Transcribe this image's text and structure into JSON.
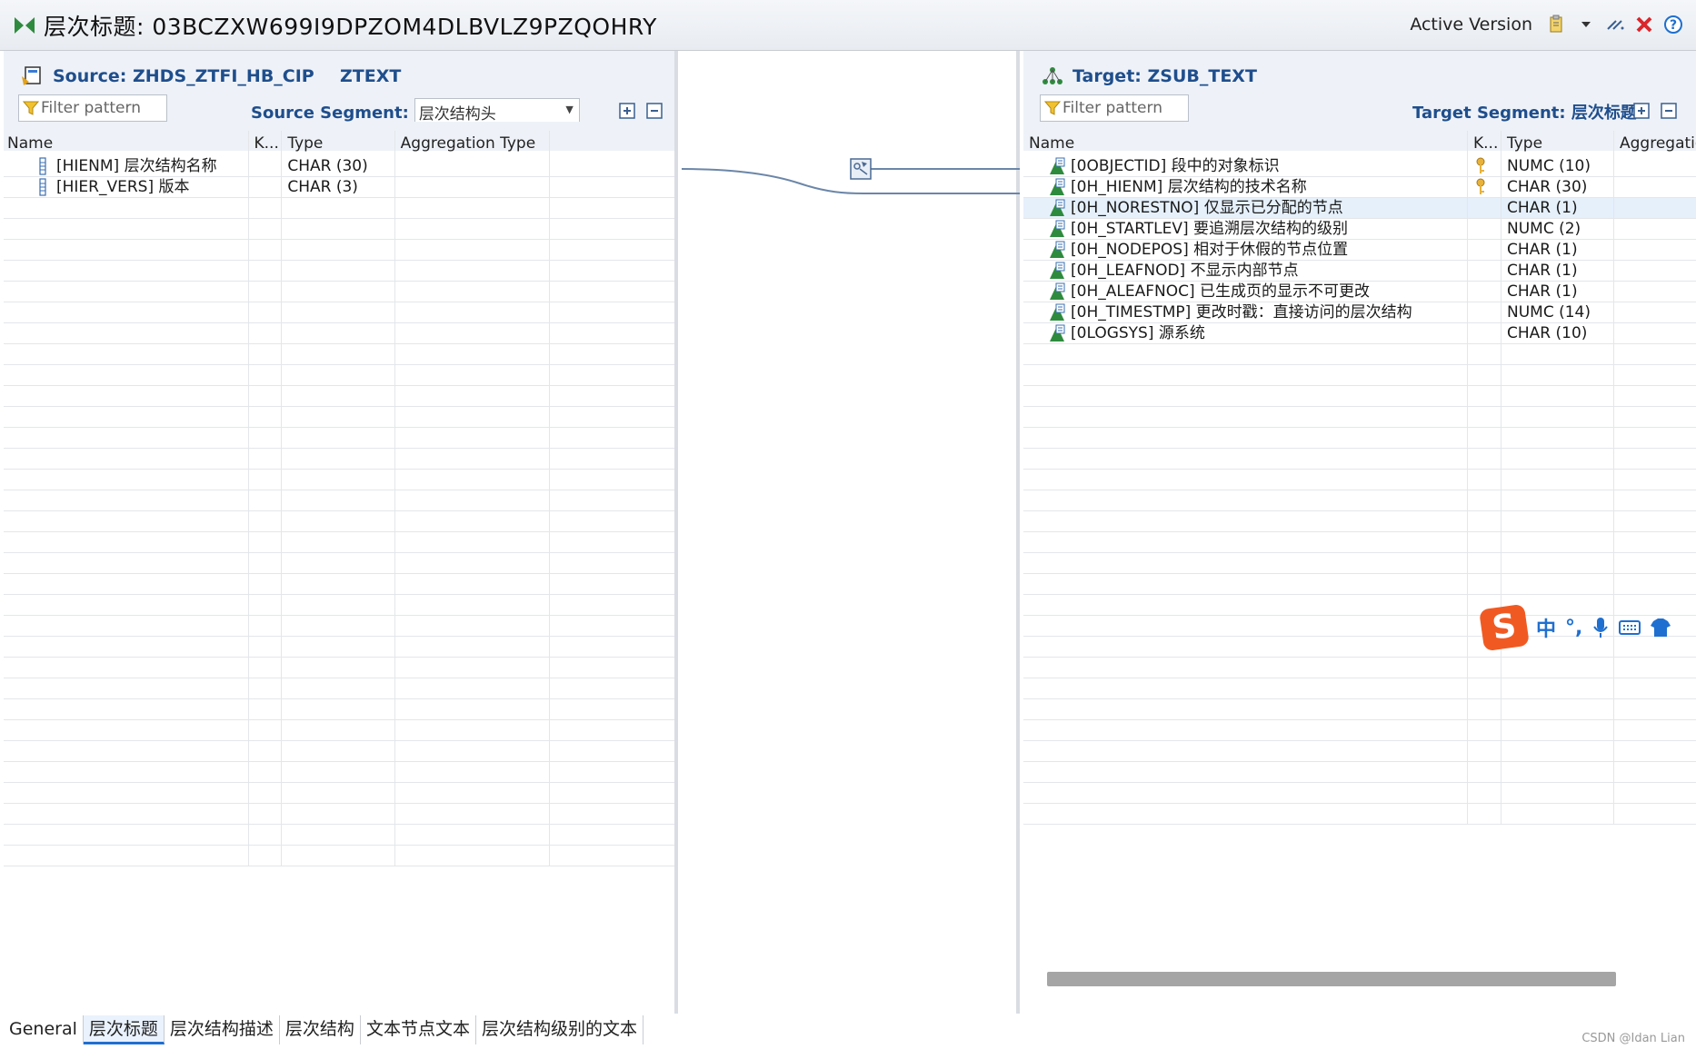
{
  "window": {
    "title": "层次标题: 03BCZXW699I9DPZOM4DLBVLZ9PZQOHRY",
    "version_label": "Active Version"
  },
  "source": {
    "title": "Source: ZHDS_ZTFI_HB_CIP",
    "ztext": "ZTEXT",
    "filter_placeholder": "Filter pattern",
    "segment_label": "Source Segment:",
    "segment_value": "层次结构头",
    "columns": [
      "Name",
      "K...",
      "Type",
      "Aggregation Type",
      ""
    ],
    "rows": [
      {
        "name": "[HIENM] 层次结构名称",
        "type": "CHAR (30)"
      },
      {
        "name": "[HIER_VERS] 版本",
        "type": "CHAR (3)"
      }
    ]
  },
  "target": {
    "title": "Target: ZSUB_TEXT",
    "filter_placeholder": "Filter pattern",
    "segment_label": "Target Segment: 层次标题",
    "columns": [
      "Name",
      "K...",
      "Type",
      "Aggregatio"
    ],
    "rows": [
      {
        "name": "[0OBJECTID] 段中的对象标识",
        "key": true,
        "type": "NUMC (10)"
      },
      {
        "name": "[0H_HIENM] 层次结构的技术名称",
        "key": true,
        "type": "CHAR (30)"
      },
      {
        "name": "[0H_NORESTNO] 仅显示已分配的节点",
        "key": false,
        "type": "CHAR (1)",
        "selected": true
      },
      {
        "name": "[0H_STARTLEV] 要追溯层次结构的级别",
        "key": false,
        "type": "NUMC (2)"
      },
      {
        "name": "[0H_NODEPOS] 相对于休假的节点位置",
        "key": false,
        "type": "CHAR (1)"
      },
      {
        "name": "[0H_LEAFNOD] 不显示内部节点",
        "key": false,
        "type": "CHAR (1)"
      },
      {
        "name": "[0H_ALEAFNOC] 已生成页的显示不可更改",
        "key": false,
        "type": "CHAR (1)"
      },
      {
        "name": "[0H_TIMESTMP] 更改时戳：直接访问的层次结构",
        "key": false,
        "type": "NUMC (14)"
      },
      {
        "name": "[0LOGSYS] 源系统",
        "key": false,
        "type": "CHAR (10)"
      }
    ]
  },
  "tabs": [
    "General",
    "层次标题",
    "层次结构描述",
    "层次结构",
    "文本节点文本",
    "层次结构级别的文本"
  ],
  "active_tab": 1,
  "ime": {
    "mode": "中",
    "punct": "°,"
  },
  "watermark": "CSDN @Idan Lian",
  "colors": {
    "accent": "#1f4e8c",
    "selected_row": "#e5f0fb",
    "close_red": "#d9262c"
  }
}
